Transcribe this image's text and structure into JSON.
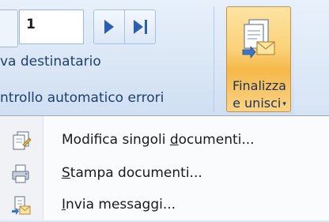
{
  "ribbon": {
    "record_number": "1",
    "line1_text": "va destinatario",
    "line2_text": "ntrollo automatico errori",
    "finalize_button": {
      "label_line1": "Finalizza",
      "label_line2": "e unisci",
      "caret": "▾"
    }
  },
  "menu": {
    "items": [
      {
        "pre": "Modifica singoli ",
        "accel": "d",
        "post": "ocumenti...",
        "icon": "edit-documents-icon"
      },
      {
        "pre": "",
        "accel": "S",
        "post": "tampa documenti...",
        "icon": "print-documents-icon"
      },
      {
        "pre": "",
        "accel": "I",
        "post": "nvia messaggi...",
        "icon": "send-email-icon"
      }
    ]
  },
  "colors": {
    "accent_orange": "#f6b84a",
    "ribbon_text": "#1f3f6b",
    "nav_arrow": "#2d5fb0"
  }
}
